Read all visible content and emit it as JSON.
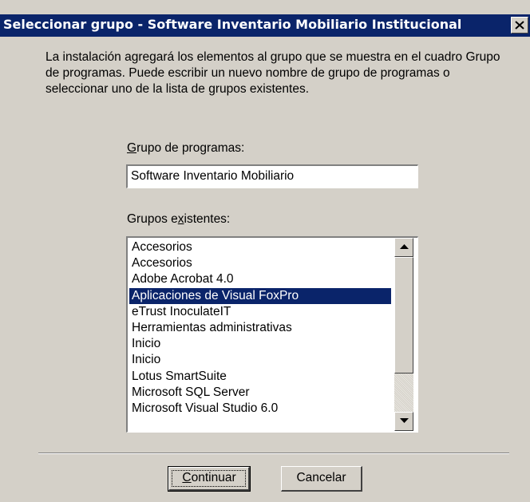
{
  "window": {
    "title": "Seleccionar grupo - Software Inventario Mobiliario Institucional",
    "close_icon": "close-icon"
  },
  "description": "La instalación agregará los elementos al grupo que se muestra en el cuadro Grupo de programas. Puede escribir un nuevo nombre de grupo de programas o seleccionar uno de la lista de grupos existentes.",
  "group_field": {
    "label_accel": "G",
    "label_rest": "rupo de programas:",
    "value": "Software Inventario Mobiliario"
  },
  "existing_groups": {
    "label_pre": "Grupos e",
    "label_accel": "x",
    "label_post": "istentes:",
    "selected_index": 3,
    "items": [
      "Accesorios",
      "Accesorios",
      "Adobe Acrobat 4.0",
      "Aplicaciones de Visual FoxPro",
      "eTrust InoculateIT",
      "Herramientas administrativas",
      "Inicio",
      "Inicio",
      "Lotus SmartSuite",
      "Microsoft SQL Server",
      "Microsoft Visual Studio 6.0"
    ]
  },
  "buttons": {
    "continue_accel": "C",
    "continue_rest": "ontinuar",
    "cancel": "Cancelar"
  },
  "colors": {
    "titlebar": "#0a246a",
    "face": "#d4d0c8",
    "selection": "#0a246a"
  }
}
